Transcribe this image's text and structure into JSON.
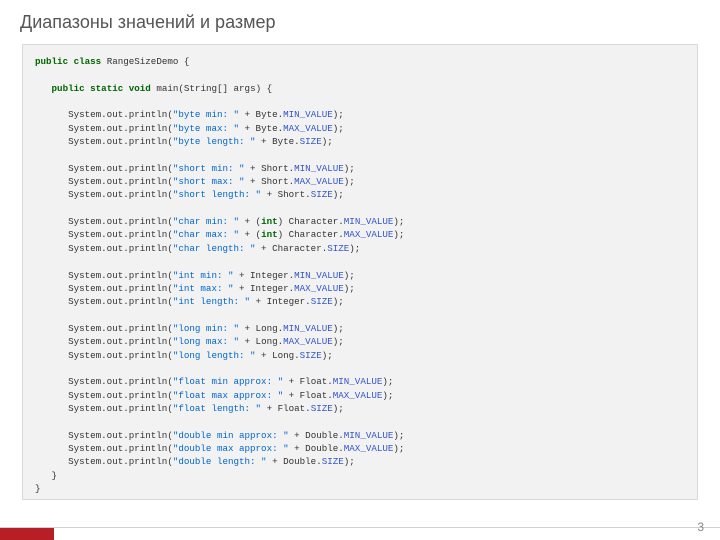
{
  "title": "Диапазоны значений и размер",
  "page_number": "3",
  "code": {
    "class_decl_kw1": "public",
    "class_decl_kw2": "class",
    "class_name": "RangeSizeDemo",
    "main_kw1": "public",
    "main_kw2": "static",
    "main_kw3": "void",
    "main_name": "main",
    "main_args": "String[] args",
    "lines": [
      {
        "obj": "System",
        "m1": "out",
        "m2": "println",
        "str": "\"byte min: \"",
        "plus": " + Byte.",
        "const": "MIN_VALUE",
        "end": ");"
      },
      {
        "obj": "System",
        "m1": "out",
        "m2": "println",
        "str": "\"byte max: \"",
        "plus": " + Byte.",
        "const": "MAX_VALUE",
        "end": ");"
      },
      {
        "obj": "System",
        "m1": "out",
        "m2": "println",
        "str": "\"byte length: \"",
        "plus": " + Byte.",
        "const": "SIZE",
        "end": ");"
      },
      {
        "blank": true
      },
      {
        "obj": "System",
        "m1": "out",
        "m2": "println",
        "str": "\"short min: \"",
        "plus": " + Short.",
        "const": "MIN_VALUE",
        "end": ");"
      },
      {
        "obj": "System",
        "m1": "out",
        "m2": "println",
        "str": "\"short max: \"",
        "plus": " + Short.",
        "const": "MAX_VALUE",
        "end": ");"
      },
      {
        "obj": "System",
        "m1": "out",
        "m2": "println",
        "str": "\"short length: \"",
        "plus": " + Short.",
        "const": "SIZE",
        "end": ");"
      },
      {
        "blank": true
      },
      {
        "obj": "System",
        "m1": "out",
        "m2": "println",
        "str": "\"char min: \"",
        "plus": " + (",
        "castkw": "int",
        "cast2": ") Character.",
        "const": "MIN_VALUE",
        "end": ");"
      },
      {
        "obj": "System",
        "m1": "out",
        "m2": "println",
        "str": "\"char max: \"",
        "plus": " + (",
        "castkw": "int",
        "cast2": ") Character.",
        "const": "MAX_VALUE",
        "end": ");"
      },
      {
        "obj": "System",
        "m1": "out",
        "m2": "println",
        "str": "\"char length: \"",
        "plus": " + Character.",
        "const": "SIZE",
        "end": ");"
      },
      {
        "blank": true
      },
      {
        "obj": "System",
        "m1": "out",
        "m2": "println",
        "str": "\"int min: \"",
        "plus": " + Integer.",
        "const": "MIN_VALUE",
        "end": ");"
      },
      {
        "obj": "System",
        "m1": "out",
        "m2": "println",
        "str": "\"int max: \"",
        "plus": " + Integer.",
        "const": "MAX_VALUE",
        "end": ");"
      },
      {
        "obj": "System",
        "m1": "out",
        "m2": "println",
        "str": "\"int length: \"",
        "plus": " + Integer.",
        "const": "SIZE",
        "end": ");"
      },
      {
        "blank": true
      },
      {
        "obj": "System",
        "m1": "out",
        "m2": "println",
        "str": "\"long min: \"",
        "plus": " + Long.",
        "const": "MIN_VALUE",
        "end": ");"
      },
      {
        "obj": "System",
        "m1": "out",
        "m2": "println",
        "str": "\"long max: \"",
        "plus": " + Long.",
        "const": "MAX_VALUE",
        "end": ");"
      },
      {
        "obj": "System",
        "m1": "out",
        "m2": "println",
        "str": "\"long length: \"",
        "plus": " + Long.",
        "const": "SIZE",
        "end": ");"
      },
      {
        "blank": true
      },
      {
        "obj": "System",
        "m1": "out",
        "m2": "println",
        "str": "\"float min approx: \"",
        "plus": " + Float.",
        "const": "MIN_VALUE",
        "end": ");"
      },
      {
        "obj": "System",
        "m1": "out",
        "m2": "println",
        "str": "\"float max approx: \"",
        "plus": " + Float.",
        "const": "MAX_VALUE",
        "end": ");"
      },
      {
        "obj": "System",
        "m1": "out",
        "m2": "println",
        "str": "\"float length: \"",
        "plus": " + Float.",
        "const": "SIZE",
        "end": ");"
      },
      {
        "blank": true
      },
      {
        "obj": "System",
        "m1": "out",
        "m2": "println",
        "str": "\"double min approx: \"",
        "plus": " + Double.",
        "const": "MIN_VALUE",
        "end": ");"
      },
      {
        "obj": "System",
        "m1": "out",
        "m2": "println",
        "str": "\"double max approx: \"",
        "plus": " + Double.",
        "const": "MAX_VALUE",
        "end": ");"
      },
      {
        "obj": "System",
        "m1": "out",
        "m2": "println",
        "str": "\"double length: \"",
        "plus": " + Double.",
        "const": "SIZE",
        "end": ");"
      }
    ]
  }
}
